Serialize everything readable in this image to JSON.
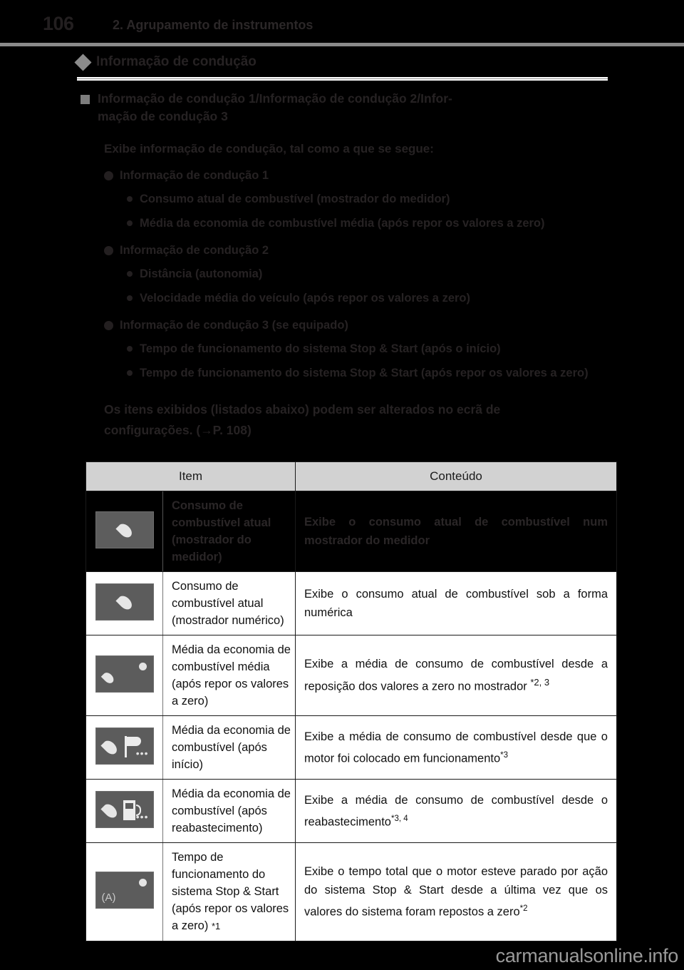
{
  "header": {
    "page_number": "106",
    "chapter_title": "2. Agrupamento de instrumentos"
  },
  "section": {
    "title": "Informação de condução",
    "bullet_icon": "diamond-bullet"
  },
  "subsection": {
    "heading_line1": "Informação de condução 1/Informação de condução 2/Infor-",
    "heading_line2": "mação de condução 3",
    "intro": "Exibe informação de condução, tal como a que se segue:",
    "groups": [
      {
        "label": "Informação de condução 1",
        "items": [
          "Consumo atual de combustível (mostrador do medidor)",
          "Média da economia de combustível média (após repor os valores a zero)"
        ]
      },
      {
        "label": "Informação de condução 2",
        "items": [
          "Distância (autonomia)",
          "Velocidade média do veículo (após repor os valores a zero)"
        ]
      },
      {
        "label": "Informação de condução 3 (se equipado)",
        "items": [
          "Tempo de funcionamento do sistema Stop & Start (após o início)",
          "Tempo de funcionamento do sistema Stop & Start (após repor os valores a zero)"
        ]
      }
    ],
    "closing_line1": "Os itens exibidos (listados abaixo) podem ser alterados no ecrã de",
    "closing_line2": "configurações. (→P. 108)"
  },
  "table": {
    "columns": [
      "Item",
      "Conteúdo"
    ],
    "rows": [
      {
        "icon": "fuel-drop-icon",
        "name": "Consumo de combustível atual (mostrador do medidor)",
        "content": "Exibe o consumo atual de combustível num mostrador do medidor",
        "footnote_name": "",
        "footnote_content": "",
        "style": "dark"
      },
      {
        "icon": "fuel-drop-icon",
        "name": "Consumo de combustível atual (mostrador numérico)",
        "content": "Exibe o consumo atual de combustível sob a forma numérica",
        "footnote_name": "",
        "footnote_content": "",
        "style": "light"
      },
      {
        "icon": "fuel-drop-dot-icon",
        "name": "Média da economia de combustível média (após repor os valores a zero)",
        "content": "Exibe a média de consumo de combustível desde a reposição dos valores a zero no mostrador",
        "footnote_name": "",
        "footnote_content": "*2, 3",
        "style": "light"
      },
      {
        "icon": "fuel-drop-flag-icon",
        "name": "Média da economia de combustível (após início)",
        "content": "Exibe a média de consumo de combustível desde que o motor foi colocado em funcionamento",
        "footnote_name": "",
        "footnote_content": "*3",
        "style": "light"
      },
      {
        "icon": "fuel-drop-pump-icon",
        "name": "Média da economia de combustível (após reabastecimento)",
        "content": "Exibe a média de consumo de combustível desde o reabastecimento",
        "footnote_name": "",
        "footnote_content": "*3, 4",
        "style": "light"
      },
      {
        "icon": "stop-start-a-icon",
        "name": "Tempo de funcionamento do sistema Stop & Start (após repor os valores a zero)",
        "content": "Exibe o tempo total que o motor esteve parado por ação do sistema Stop & Start desde a última vez que os valores do sistema foram repostos a zero",
        "footnote_name": "*1",
        "footnote_content": "*2",
        "style": "light"
      }
    ]
  },
  "watermark": "carmanualsonline.info",
  "colors": {
    "page_background": "#000000",
    "body_text": "#262223",
    "table_header_background": "#d2d2d2",
    "table_row_background": "#ffffff",
    "icon_tile": "#5c5c5c",
    "icon_glyph": "#e6e6e6",
    "watermark": "#9a9a9a"
  }
}
